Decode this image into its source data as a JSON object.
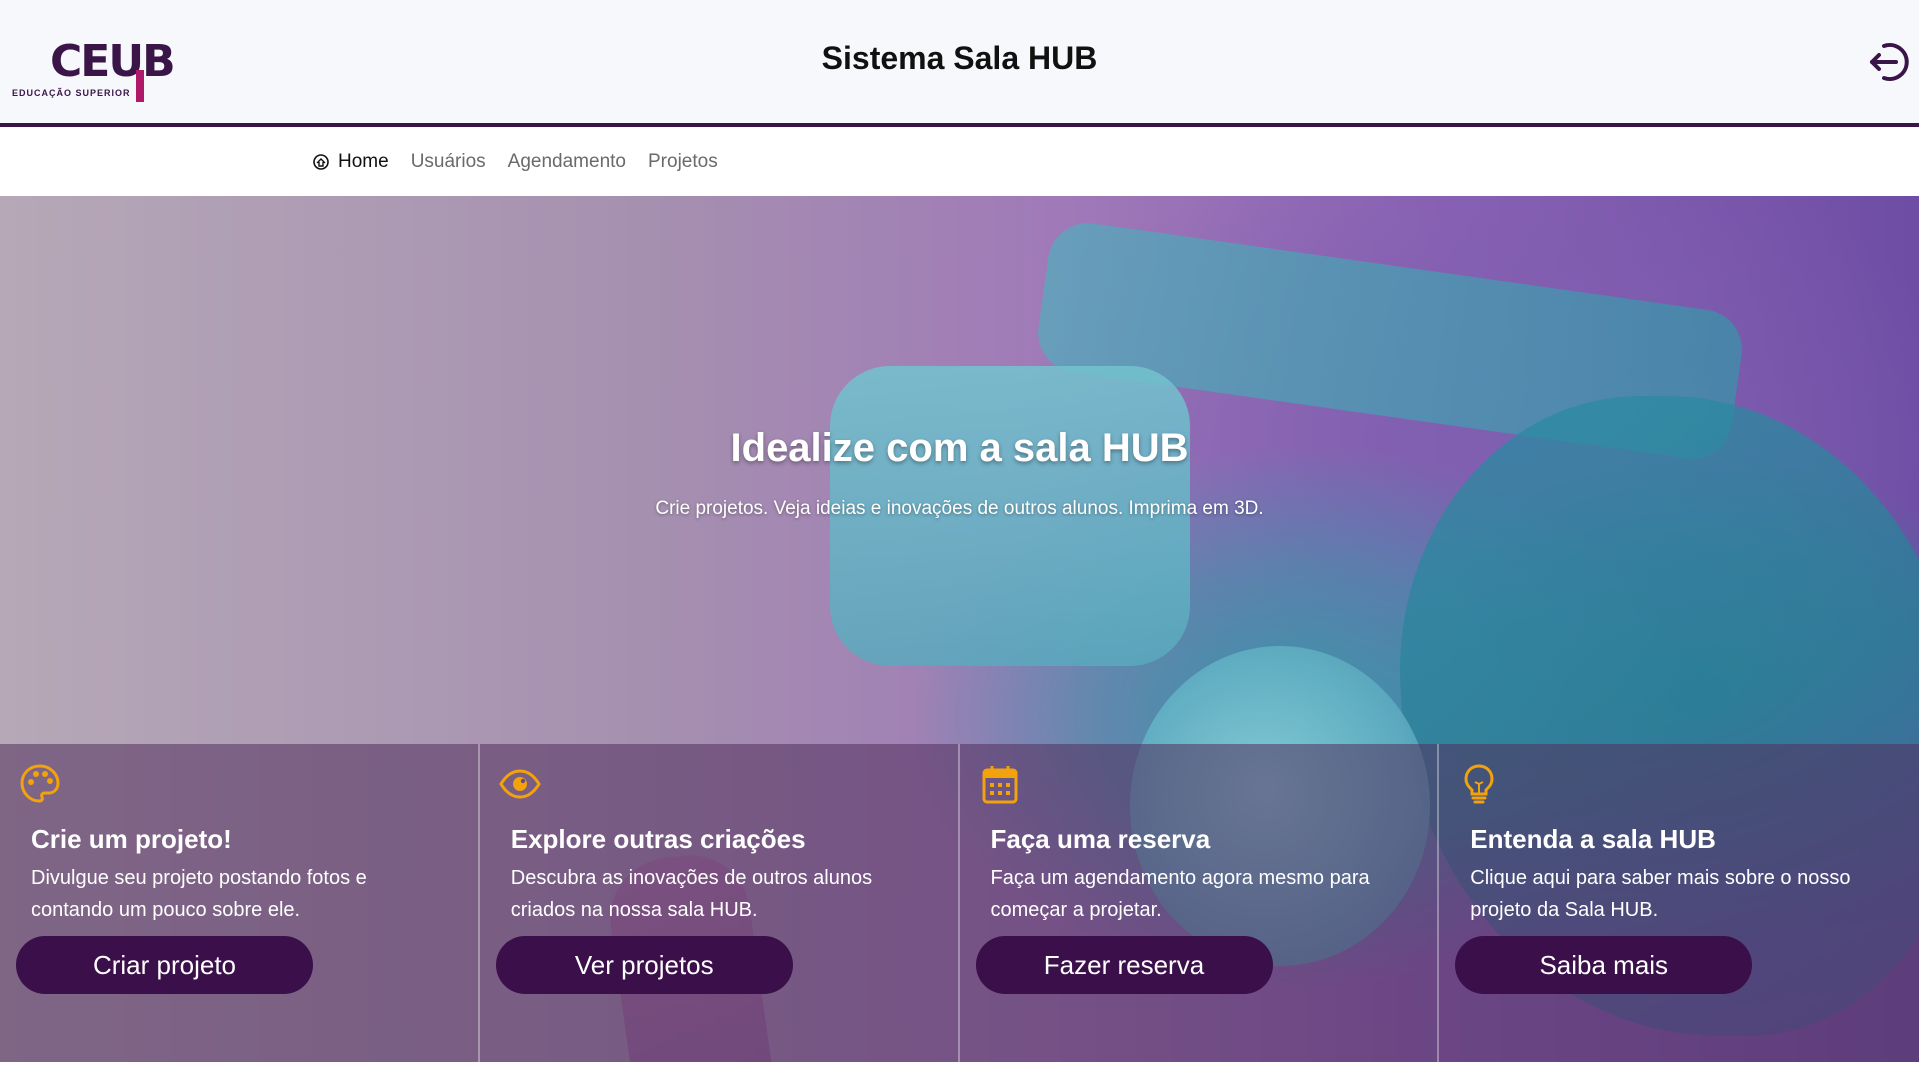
{
  "header": {
    "logo_text": "CEUB",
    "logo_subtitle": "EDUCAÇÃO SUPERIOR",
    "title": "Sistema Sala HUB",
    "logout_icon": "logout-icon"
  },
  "nav": {
    "items": [
      {
        "label": "Home",
        "icon": "home-icon",
        "active": true
      },
      {
        "label": "Usuários",
        "active": false
      },
      {
        "label": "Agendamento",
        "active": false
      },
      {
        "label": "Projetos",
        "active": false
      }
    ]
  },
  "hero": {
    "title": "Idealize com a sala HUB",
    "subtitle": "Crie projetos. Veja ideias e inovações de outros alunos. Imprima em 3D."
  },
  "cards": [
    {
      "icon": "palette-icon",
      "title": "Crie um projeto!",
      "description": "Divulgue seu projeto postando fotos e contando um pouco sobre ele.",
      "button": "Criar projeto"
    },
    {
      "icon": "eye-icon",
      "title": "Explore outras criações",
      "description": "Descubra as inovações de outros alunos criados na nossa sala HUB.",
      "button": "Ver projetos"
    },
    {
      "icon": "calendar-icon",
      "title": "Faça uma reserva",
      "description": "Faça um agendamento agora mesmo para começar a projetar.",
      "button": "Fazer reserva"
    },
    {
      "icon": "lightbulb-icon",
      "title": "Entenda a sala HUB",
      "description": "Clique aqui para saber mais sobre o nosso projeto da Sala HUB.",
      "button": "Saiba mais"
    }
  ],
  "colors": {
    "brand_purple": "#3a1548",
    "brand_magenta": "#b0186a",
    "icon_orange": "#f2a20c",
    "button_bg": "#3a0f4a"
  }
}
